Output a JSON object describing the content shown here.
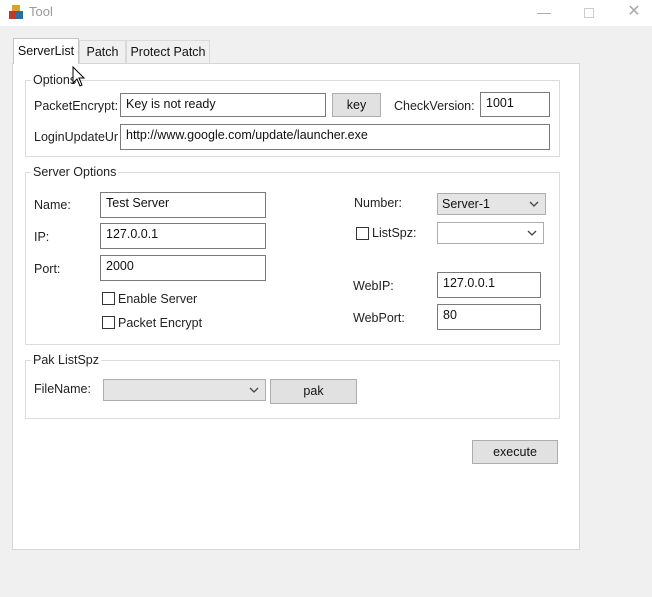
{
  "window": {
    "title": "Tool"
  },
  "tabs": [
    {
      "label": "ServerList"
    },
    {
      "label": "Patch"
    },
    {
      "label": "Protect Patch"
    }
  ],
  "options": {
    "legend": "Options",
    "packet_encrypt_label": "PacketEncrypt:",
    "packet_encrypt_value": "Key is not ready",
    "key_button": "key",
    "check_version_label": "CheckVersion:",
    "check_version_value": "1001",
    "login_update_url_label": "LoginUpdateUr",
    "login_update_url_value": "http://www.google.com/update/launcher.exe"
  },
  "server_options": {
    "legend": "Server Options",
    "name_label": "Name:",
    "name_value": "Test Server",
    "ip_label": "IP:",
    "ip_value": "127.0.0.1",
    "port_label": "Port:",
    "port_value": "2000",
    "enable_server_label": "Enable Server",
    "packet_encrypt_label": "Packet Encrypt",
    "number_label": "Number:",
    "number_value": "Server-1",
    "listspz_label": "ListSpz:",
    "listspz_value": "",
    "webip_label": "WebIP:",
    "webip_value": "127.0.0.1",
    "webport_label": "WebPort:",
    "webport_value": "80"
  },
  "pak_listspz": {
    "legend": "Pak ListSpz",
    "filename_label": "FileName:",
    "filename_value": "",
    "pak_button": "pak"
  },
  "execute_button": "execute"
}
